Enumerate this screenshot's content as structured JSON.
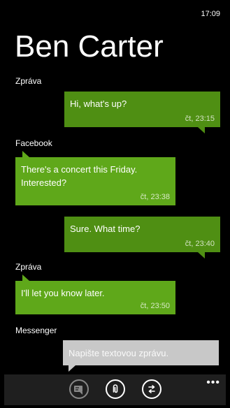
{
  "status": {
    "time": "17:09"
  },
  "contact": {
    "name": "Ben Carter"
  },
  "messages": [
    {
      "channel": "Zpráva",
      "direction": "out",
      "text": "Hi, what's up?",
      "time": "čt, 23:15"
    },
    {
      "channel": "Facebook",
      "direction": "in",
      "text": "There's a concert this Friday. Interested?",
      "time": "čt, 23:38"
    },
    {
      "channel": "",
      "direction": "out",
      "text": "Sure. What time?",
      "time": "čt, 23:40"
    },
    {
      "channel": "Zpráva",
      "direction": "in",
      "text": "I'll let you know later.",
      "time": "čt, 23:50"
    }
  ],
  "compose": {
    "channel": "Messenger",
    "placeholder": "Napište textovou zprávu."
  },
  "appbar": {
    "buttons": [
      {
        "name": "voice",
        "icon": "speech-to-text-icon",
        "enabled": false
      },
      {
        "name": "attach",
        "icon": "paperclip-icon",
        "enabled": true
      },
      {
        "name": "switch",
        "icon": "switch-channel-icon",
        "enabled": true
      }
    ],
    "more": "•••"
  },
  "colors": {
    "background": "#000000",
    "bubble_out": "#4f8f13",
    "bubble_in": "#5fa81a",
    "compose_bg": "#c8c8c8",
    "appbar_bg": "#1f1f1f"
  }
}
